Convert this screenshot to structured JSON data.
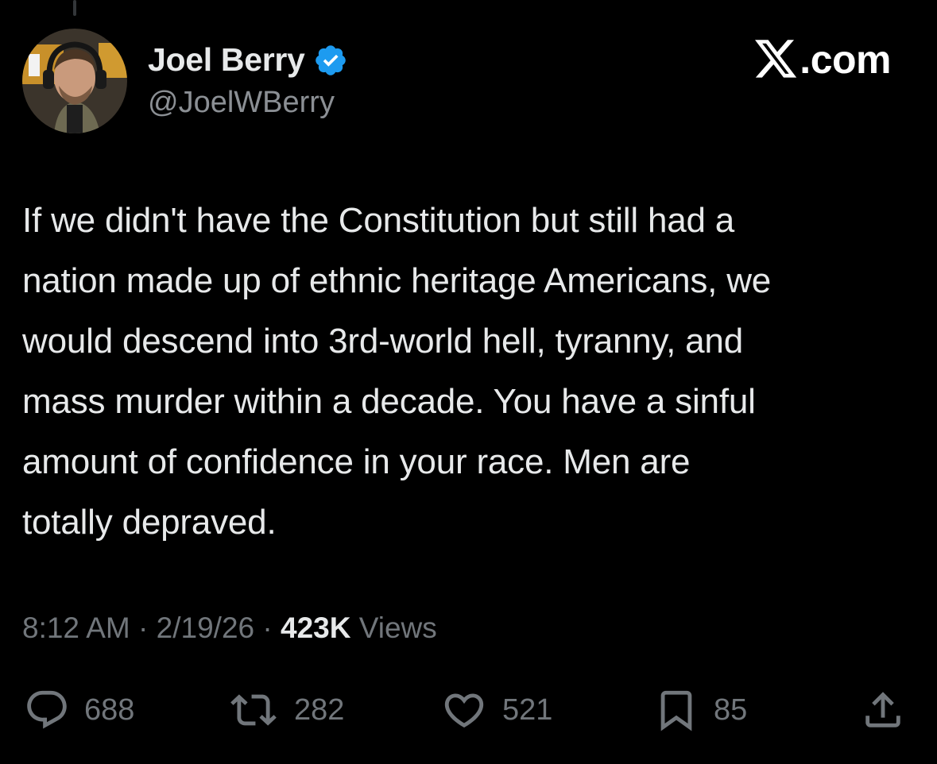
{
  "author": {
    "display_name": "Joel Berry",
    "handle": "@JoelWBerry",
    "verified": true,
    "avatar_icon": "avatar-photo"
  },
  "brand": {
    "label": ".com",
    "icon": "x-logo-icon"
  },
  "tweet": {
    "text": "If we didn't have the Constitution but still had a\nnation made up of ethnic heritage Americans, we\nwould descend into 3rd-world hell, tyranny, and\nmass murder within a decade. You have a sinful\namount of confidence in your race. Men are\ntotally depraved."
  },
  "meta": {
    "time": "8:12 AM",
    "separator": " · ",
    "date": "2/19/26",
    "views_count": "423K",
    "views_label": " Views"
  },
  "actions": {
    "replies": "688",
    "reposts": "282",
    "likes": "521",
    "bookmarks": "85"
  },
  "colors": {
    "background": "#000000",
    "text": "#e7e9ea",
    "secondary": "#71767b",
    "verified": "#1d9bf0"
  }
}
